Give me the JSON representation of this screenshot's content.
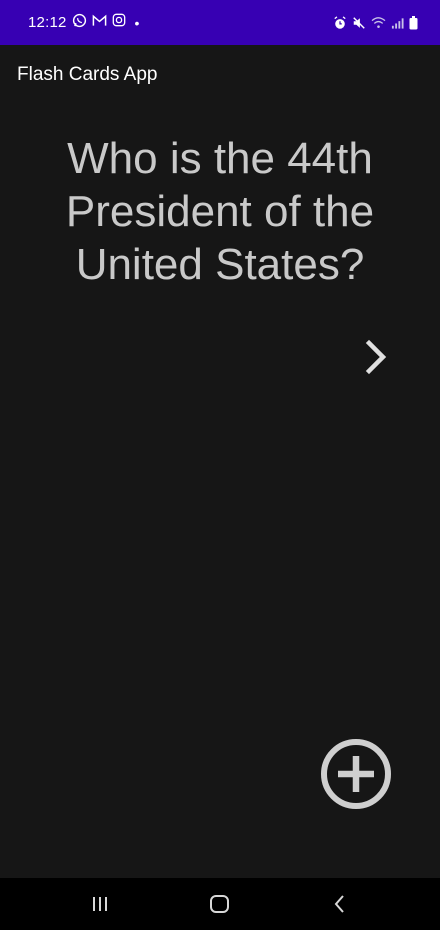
{
  "status_bar": {
    "time": "12:12",
    "notification_icons": [
      "whatsapp-icon",
      "gmail-icon",
      "instagram-icon"
    ],
    "dot": "•",
    "system_icons": [
      "alarm-icon",
      "mute-icon",
      "wifi-icon",
      "signal-icon",
      "battery-icon"
    ],
    "background": "#3700b3"
  },
  "app_bar": {
    "title": "Flash Cards App"
  },
  "card": {
    "question": "Who is the 44th President of the United States?"
  },
  "actions": {
    "next_icon": "chevron-right-icon",
    "add_icon": "add-circle-icon"
  },
  "nav_bar": {
    "buttons": [
      "recent-apps-icon",
      "home-icon",
      "back-icon"
    ]
  }
}
